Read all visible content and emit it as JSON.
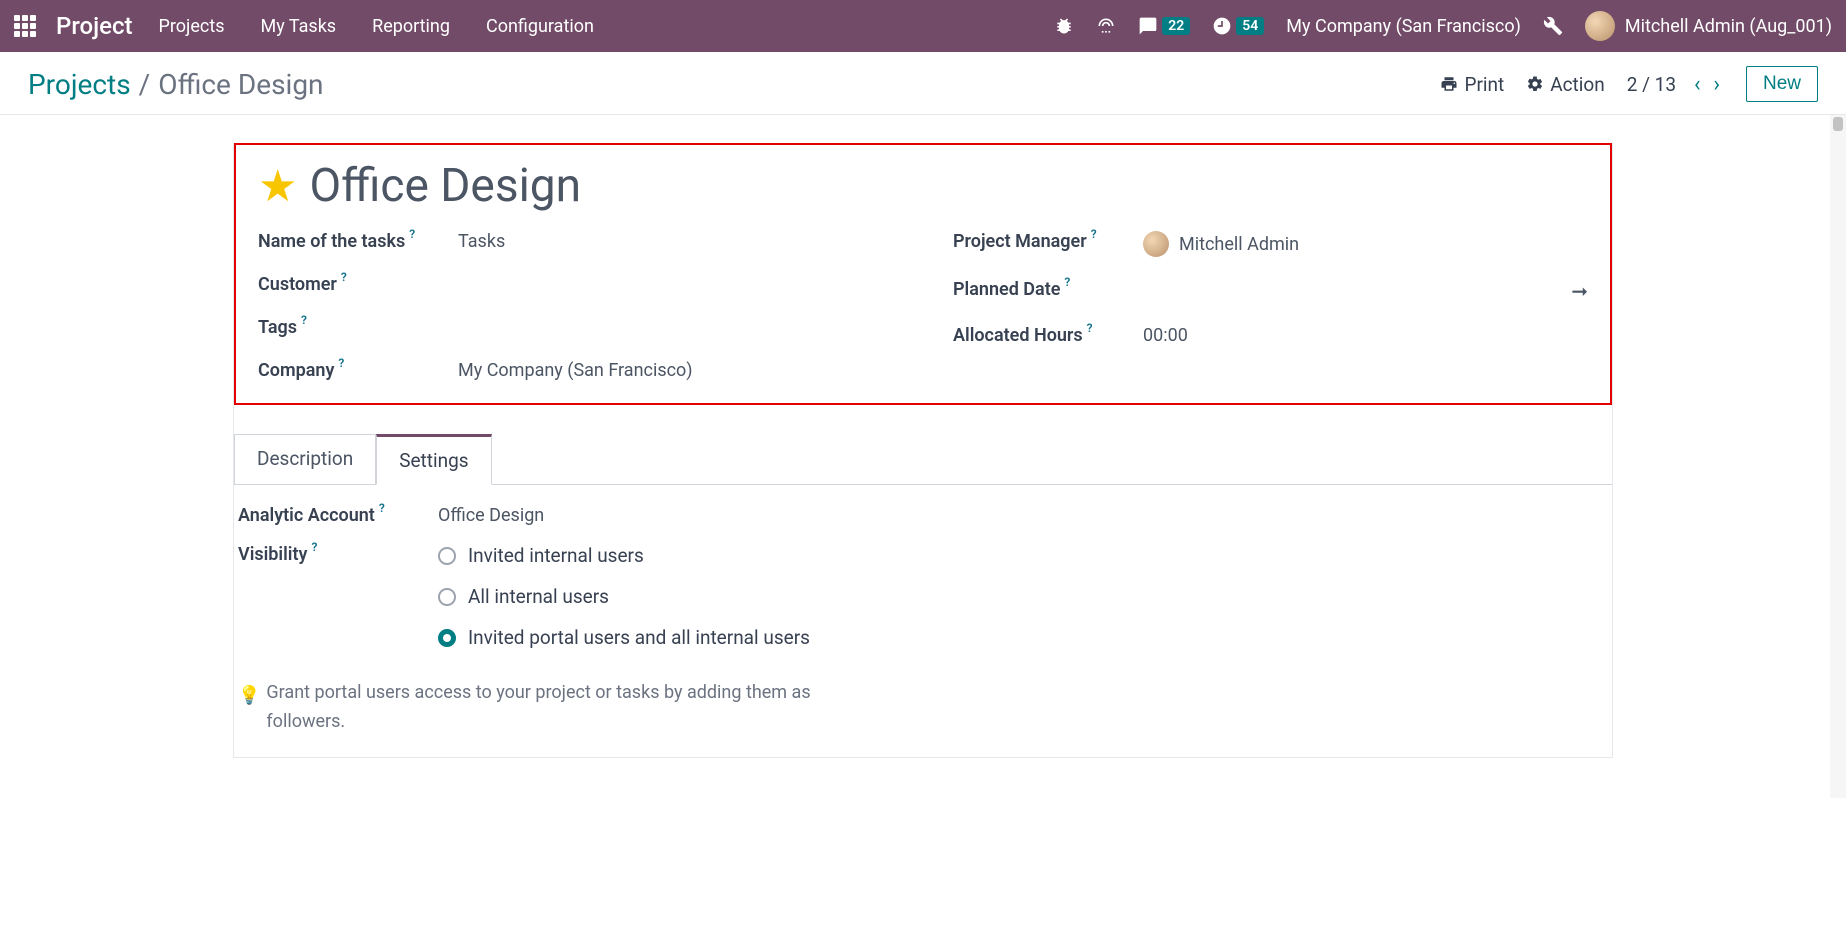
{
  "navbar": {
    "brand": "Project",
    "menu": [
      "Projects",
      "My Tasks",
      "Reporting",
      "Configuration"
    ],
    "messages_count": "22",
    "activities_count": "54",
    "company": "My Company (San Francisco)",
    "user": "Mitchell Admin (Aug_001)"
  },
  "breadcrumb": {
    "parent": "Projects",
    "current": "Office Design"
  },
  "controls": {
    "print": "Print",
    "action": "Action",
    "pager": "2 / 13",
    "new": "New"
  },
  "form": {
    "title": "Office Design",
    "left": {
      "name_label": "Name of the tasks",
      "name_value": "Tasks",
      "customer_label": "Customer",
      "customer_value": "",
      "tags_label": "Tags",
      "tags_value": "",
      "company_label": "Company",
      "company_value": "My Company (San Francisco)"
    },
    "right": {
      "manager_label": "Project Manager",
      "manager_value": "Mitchell Admin",
      "planned_label": "Planned Date",
      "planned_value": "",
      "hours_label": "Allocated Hours",
      "hours_value": "00:00"
    }
  },
  "tabs": {
    "description": "Description",
    "settings": "Settings"
  },
  "settings": {
    "analytic_label": "Analytic Account",
    "analytic_value": "Office Design",
    "visibility_label": "Visibility",
    "visibility_options": {
      "opt1": "Invited internal users",
      "opt2": "All internal users",
      "opt3": "Invited portal users and all internal users"
    },
    "hint": "Grant portal users access to your project or tasks by adding them as followers."
  }
}
